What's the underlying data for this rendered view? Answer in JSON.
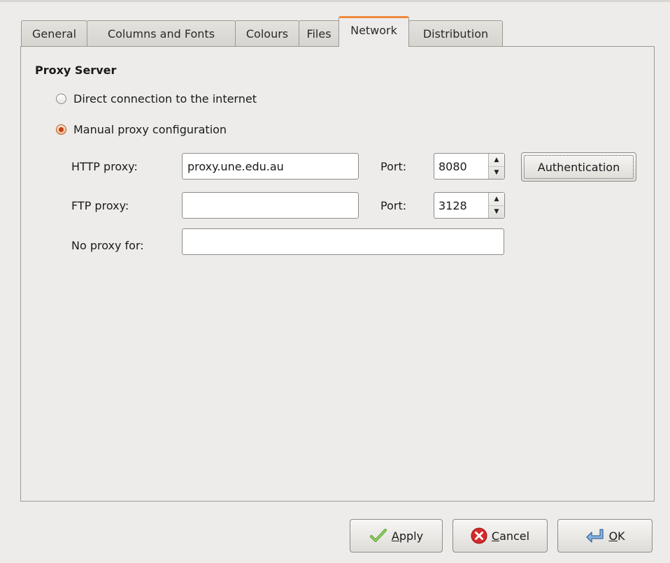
{
  "tabs": [
    {
      "label": "General"
    },
    {
      "label": "Columns and Fonts"
    },
    {
      "label": "Colours"
    },
    {
      "label": "Files"
    },
    {
      "label": "Network",
      "active": true
    },
    {
      "label": "Distribution"
    }
  ],
  "proxy": {
    "section_title": "Proxy Server",
    "direct_label": "Direct connection to the internet",
    "manual_label": "Manual proxy configuration",
    "http_label": "HTTP proxy:",
    "http_value": "proxy.une.edu.au",
    "http_port_label": "Port:",
    "http_port_value": "8080",
    "ftp_label": "FTP proxy:",
    "ftp_value": "",
    "ftp_port_label": "Port:",
    "ftp_port_value": "3128",
    "noproxy_label": "No proxy for:",
    "noproxy_value": "",
    "auth_button": "Authentication"
  },
  "buttons": {
    "apply_first": "A",
    "apply_rest": "pply",
    "cancel_first": "C",
    "cancel_rest": "ancel",
    "ok_first": "O",
    "ok_rest": "K"
  },
  "icons": {
    "apply": "check-icon",
    "cancel": "cancel-icon",
    "ok": "return-arrow-icon"
  },
  "colors": {
    "active_tab_accent": "#f08a3c",
    "radio_selected": "#c2431a"
  }
}
